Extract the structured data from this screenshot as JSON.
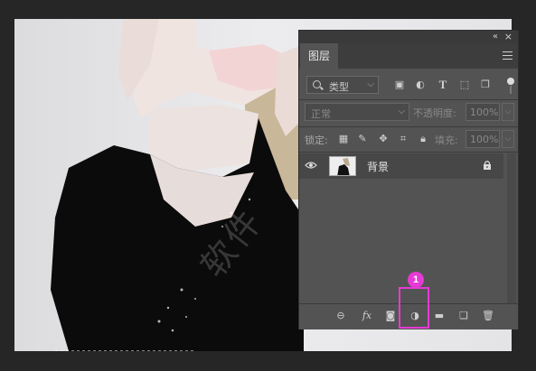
{
  "panel": {
    "tab_label": "图层",
    "filter": {
      "kind_label": "类型"
    },
    "blend": {
      "mode": "正常",
      "opacity_label": "不透明度:",
      "opacity_value": "100%"
    },
    "lock": {
      "label": "锁定:",
      "fill_label": "填充:",
      "fill_value": "100%"
    },
    "layers": [
      {
        "name": "背景",
        "visible": true,
        "locked": true
      }
    ]
  },
  "callout": {
    "number": "1",
    "color": "#e53ad4"
  },
  "watermark": "软件"
}
